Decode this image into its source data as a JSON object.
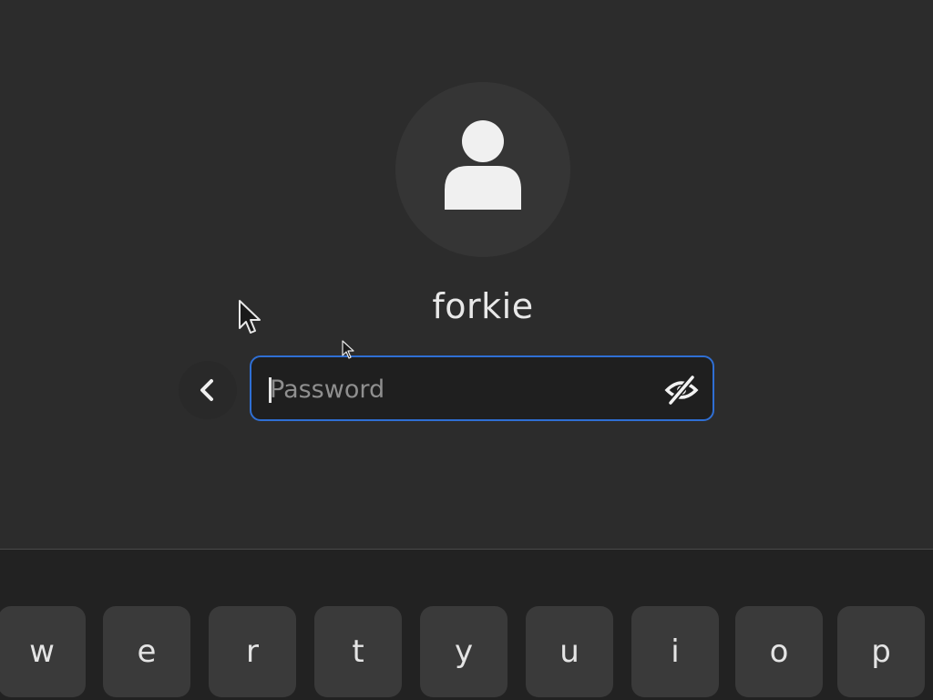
{
  "login": {
    "username": "forkie",
    "password_placeholder": "Password",
    "password_value": ""
  },
  "icons": {
    "avatar": "user-avatar-icon",
    "back": "chevron-left-icon",
    "reveal": "eye-slash-icon",
    "pointer": "mouse-pointer-icon"
  },
  "colors": {
    "background": "#2c2c2c",
    "keyboard_background": "#222222",
    "key_background": "#3a3a3a",
    "focus_accent": "#2f6fd4",
    "text": "#e8e8e8"
  },
  "keyboard": {
    "keys": [
      "w",
      "e",
      "r",
      "t",
      "y",
      "u",
      "i",
      "o",
      "p"
    ]
  }
}
